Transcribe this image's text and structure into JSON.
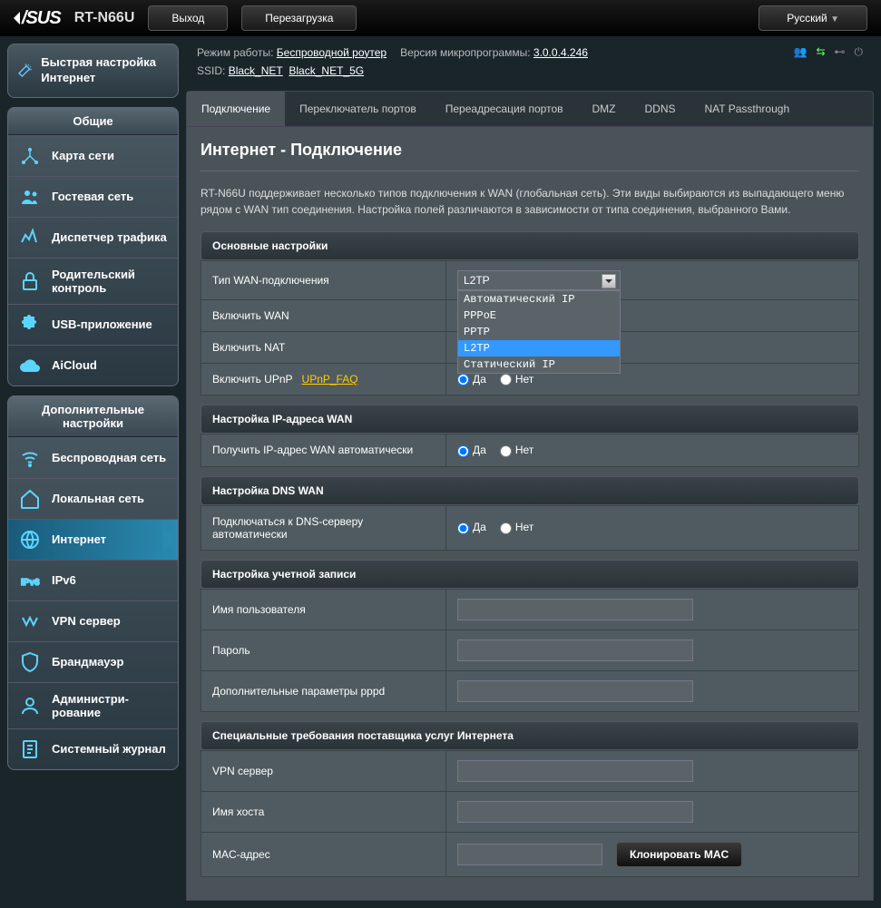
{
  "top": {
    "model": "RT-N66U",
    "logout": "Выход",
    "reboot": "Перезагрузка",
    "lang": "Русский"
  },
  "info": {
    "mode_lbl": "Режим работы:",
    "mode": "Беспроводной роутер",
    "fw_lbl": "Версия микропрограммы:",
    "fw": "3.0.0.4.246",
    "ssid_lbl": "SSID:",
    "ssid1": "Black_NET",
    "ssid2": "Black_NET_5G"
  },
  "qis": "Быстрая настройка Интернет",
  "sec1": {
    "title": "Общие",
    "items": [
      "Карта сети",
      "Гостевая сеть",
      "Диспетчер трафика",
      "Родительский контроль",
      "USB-приложение",
      "AiCloud"
    ]
  },
  "sec2": {
    "title": "Дополнительные настройки",
    "items": [
      "Беспроводная сеть",
      "Локальная сеть",
      "Интернет",
      "IPv6",
      "VPN сервер",
      "Брандмауэр",
      "Администри-рование",
      "Системный журнал"
    ]
  },
  "tabs": [
    "Подключение",
    "Переключатель портов",
    "Переадресация портов",
    "DMZ",
    "DDNS",
    "NAT Passthrough"
  ],
  "page": {
    "title": "Интернет - Подключение",
    "desc": "RT-N66U поддерживает несколько типов подключения к WAN (глобальная сеть). Эти виды выбираются из выпадающего меню рядом с WAN тип соединения. Настройка полей различаются в зависимости от типа соединения, выбранного Вами."
  },
  "s_basic": "Основные настройки",
  "wan_type": {
    "lbl": "Тип WAN-подключения",
    "value": "L2TP",
    "opts": [
      "Автоматический IP",
      "PPPoE",
      "PPTP",
      "L2TP",
      "Статический IP"
    ]
  },
  "en_wan": "Включить WAN",
  "en_nat": "Включить NAT",
  "en_upnp": {
    "lbl": "Включить UPnP",
    "faq": "UPnP_FAQ"
  },
  "yes": "Да",
  "no": "Нет",
  "s_ip": "Настройка IP-адреса WAN",
  "auto_ip": "Получить IP-адрес WAN автоматически",
  "s_dns": "Настройка DNS WAN",
  "auto_dns": "Подключаться к DNS-серверу автоматически",
  "s_acct": "Настройка учетной записи",
  "user": "Имя пользователя",
  "pass": "Пароль",
  "pppd": "Дополнительные параметры pppd",
  "s_isp": "Специальные требования поставщика услуг Интернета",
  "vpn": "VPN сервер",
  "host": "Имя хоста",
  "mac": "MAC-адрес",
  "clone": "Клонировать MAC"
}
